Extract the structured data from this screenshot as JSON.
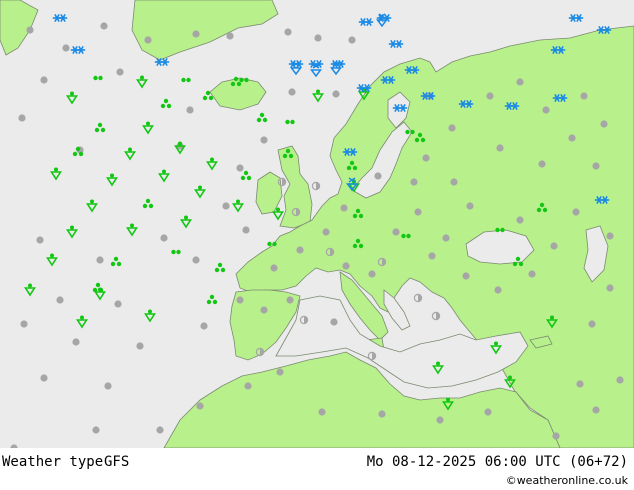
{
  "title": "Weather type",
  "model": "GFS",
  "valid_time": "Mo 08-12-2025 06:00 UTC (06+72)",
  "credit": "©weatheronline.co.uk",
  "colors": {
    "sea": "#ebebeb",
    "land": "#b8f08c",
    "border": "#7a8a70",
    "dry": "#a6a6a6",
    "rain": "#12c712",
    "snow": "#1a8ae6"
  },
  "symbol_types": [
    "dry-dot",
    "partly-dry",
    "rain-dots",
    "rain-shower",
    "showers",
    "snow",
    "snow-shower"
  ]
}
